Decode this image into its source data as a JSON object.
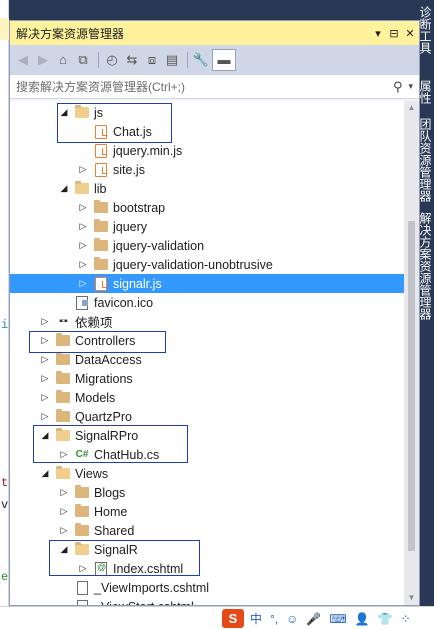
{
  "panel": {
    "title": "解决方案资源管理器",
    "title_buttons": [
      "▾",
      "⊟",
      "✕"
    ]
  },
  "toolbar": {
    "back": "◀",
    "forward": "▶",
    "home": "⌂",
    "switch_views": "⧉",
    "history": "◴",
    "sync": "⇆",
    "collapse": "⧈",
    "show_all": "▤",
    "properties": "🔧",
    "preview": "▬"
  },
  "search": {
    "placeholder": "搜索解决方案资源管理器(Ctrl+;)",
    "icon": "⚲",
    "dropdown": "▾"
  },
  "tree": [
    {
      "label": "js",
      "type": "folder-open",
      "indent": 1,
      "expander": "◢"
    },
    {
      "label": "Chat.js",
      "type": "js",
      "indent": 2,
      "expander": ""
    },
    {
      "label": "jquery.min.js",
      "type": "js",
      "indent": 2,
      "expander": ""
    },
    {
      "label": "site.js",
      "type": "js",
      "indent": 2,
      "expander": "▷"
    },
    {
      "label": "lib",
      "type": "folder-open",
      "indent": 1,
      "expander": "◢"
    },
    {
      "label": "bootstrap",
      "type": "folder",
      "indent": 2,
      "expander": "▷"
    },
    {
      "label": "jquery",
      "type": "folder",
      "indent": 2,
      "expander": "▷"
    },
    {
      "label": "jquery-validation",
      "type": "folder",
      "indent": 2,
      "expander": "▷"
    },
    {
      "label": "jquery-validation-unobtrusive",
      "type": "folder",
      "indent": 2,
      "expander": "▷"
    },
    {
      "label": "signalr.js",
      "type": "js",
      "indent": 2,
      "expander": "▷",
      "selected": true
    },
    {
      "label": "favicon.ico",
      "type": "fav",
      "indent": 1,
      "expander": ""
    },
    {
      "label": "依赖项",
      "type": "dep",
      "indent": 0,
      "expander": "▷"
    },
    {
      "label": "Controllers",
      "type": "folder",
      "indent": 0,
      "expander": "▷"
    },
    {
      "label": "DataAccess",
      "type": "folder",
      "indent": 0,
      "expander": "▷"
    },
    {
      "label": "Migrations",
      "type": "folder",
      "indent": 0,
      "expander": "▷"
    },
    {
      "label": "Models",
      "type": "folder",
      "indent": 0,
      "expander": "▷"
    },
    {
      "label": "QuartzPro",
      "type": "folder",
      "indent": 0,
      "expander": "▷"
    },
    {
      "label": "SignalRPro",
      "type": "folder-open",
      "indent": 0,
      "expander": "◢"
    },
    {
      "label": "ChatHub.cs",
      "type": "cs",
      "indent": 1,
      "expander": "▷"
    },
    {
      "label": "Views",
      "type": "folder-open",
      "indent": 0,
      "expander": "◢"
    },
    {
      "label": "Blogs",
      "type": "folder",
      "indent": 1,
      "expander": "▷"
    },
    {
      "label": "Home",
      "type": "folder",
      "indent": 1,
      "expander": "▷"
    },
    {
      "label": "Shared",
      "type": "folder",
      "indent": 1,
      "expander": "▷"
    },
    {
      "label": "SignalR",
      "type": "folder-open",
      "indent": 1,
      "expander": "◢"
    },
    {
      "label": "Index.cshtml",
      "type": "html",
      "indent": 2,
      "expander": "▷"
    },
    {
      "label": "_ViewImports.cshtml",
      "type": "doc",
      "indent": 1,
      "expander": ""
    },
    {
      "label": "_ViewStart.cshtml",
      "type": "doc",
      "indent": 1,
      "expander": ""
    }
  ],
  "dock_tabs": [
    "诊断工具",
    "属性",
    "团队资源管理器",
    "解决方案资源管理器"
  ],
  "editor_fragments": [
    "i",
    "t",
    "v",
    "e"
  ],
  "ime": {
    "logo": "S",
    "items": [
      "中",
      "°,",
      "☺",
      "🎤",
      "⌨",
      "👤",
      "👕",
      "⁘"
    ]
  },
  "colors": {
    "selection": "#3399ff",
    "highlight_box": "#1f3fb0",
    "title_bar": "#fff29d",
    "dock": "#293955"
  }
}
